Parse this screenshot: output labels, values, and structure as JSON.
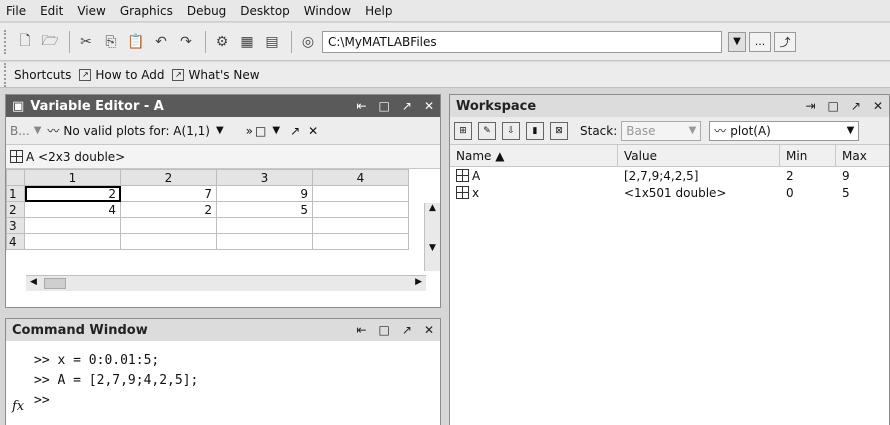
{
  "menu": [
    "File",
    "Edit",
    "View",
    "Graphics",
    "Debug",
    "Desktop",
    "Window",
    "Help"
  ],
  "toolbar": {
    "current_folder": "C:\\MyMATLABFiles",
    "browse_label": "..."
  },
  "shortcuts": {
    "label": "Shortcuts",
    "how_to_add": "How to Add",
    "whats_new": "What's New"
  },
  "variable_editor": {
    "title": "Variable Editor - A",
    "var_select": "B...",
    "plot_msg": "No valid plots for: A(1,1)",
    "var_info": "A <2x3 double>",
    "columns": [
      "1",
      "2",
      "3",
      "4"
    ],
    "rows": [
      {
        "h": "1",
        "cells": [
          "2",
          "7",
          "9",
          ""
        ]
      },
      {
        "h": "2",
        "cells": [
          "4",
          "2",
          "5",
          ""
        ]
      },
      {
        "h": "3",
        "cells": [
          "",
          "",
          "",
          ""
        ]
      },
      {
        "h": "4",
        "cells": [
          "",
          "",
          "",
          ""
        ]
      }
    ]
  },
  "command_window": {
    "title": "Command Window",
    "lines": [
      ">> x = 0:0.01:5;",
      ">> A = [2,7,9;4,2,5];",
      ">>"
    ],
    "fx": "fx"
  },
  "workspace": {
    "title": "Workspace",
    "stack_label": "Stack:",
    "stack_value": "Base",
    "plot_value": "plot(A)",
    "headers": {
      "name": "Name ▲",
      "value": "Value",
      "min": "Min",
      "max": "Max"
    },
    "vars": [
      {
        "name": "A",
        "value": "[2,7,9;4,2,5]",
        "min": "2",
        "max": "9"
      },
      {
        "name": "x",
        "value": "<1x501 double>",
        "min": "0",
        "max": "5"
      }
    ]
  }
}
